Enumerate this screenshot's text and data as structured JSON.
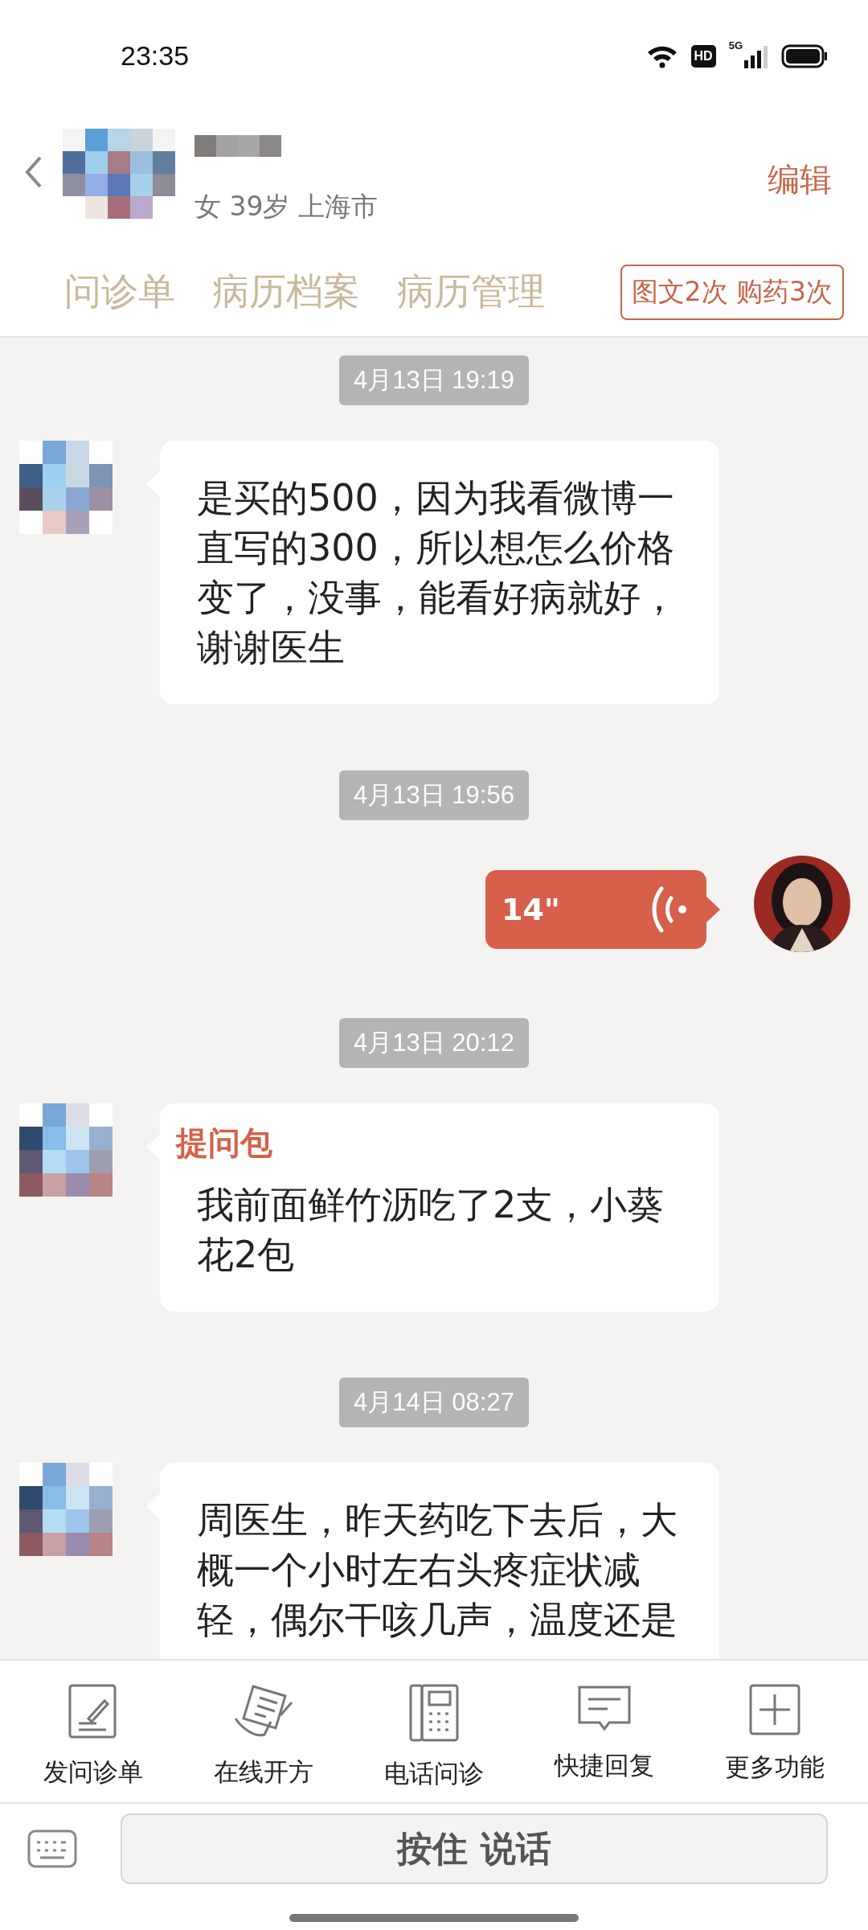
{
  "status_bar": {
    "time": "23:35",
    "hd": "HD",
    "network": "5G"
  },
  "patient": {
    "info": "女 39岁 上海市",
    "edit": "编辑"
  },
  "tabs": [
    {
      "label": "问诊单"
    },
    {
      "label": "病历档案"
    },
    {
      "label": "病历管理"
    }
  ],
  "badge": "图文2次 购药3次",
  "messages": [
    {
      "kind": "time",
      "text": "4月13日 19:19"
    },
    {
      "kind": "text",
      "body": "是买的500，因为我看微博一直写的300，所以想怎么价格变了，没事，能看好病就好，谢谢医生"
    },
    {
      "kind": "time",
      "text": "4月13日 19:56"
    },
    {
      "kind": "voice",
      "duration": "14\""
    },
    {
      "kind": "time",
      "text": "4月13日 20:12"
    },
    {
      "kind": "text",
      "title": "提问包",
      "body": "我前面鲜竹沥吃了2支，小葵花2包"
    },
    {
      "kind": "time",
      "text": "4月14日 08:27"
    },
    {
      "kind": "text",
      "body": "周医生，昨天药吃下去后，大概一个小时左右头疼症状减轻，偶尔干咳几声，温度还是"
    }
  ],
  "toolbar": [
    {
      "label": "发问诊单"
    },
    {
      "label": "在线开方"
    },
    {
      "label": "电话问诊"
    },
    {
      "label": "快捷回复"
    },
    {
      "label": "更多功能"
    }
  ],
  "input": {
    "button": "按住 说话"
  }
}
